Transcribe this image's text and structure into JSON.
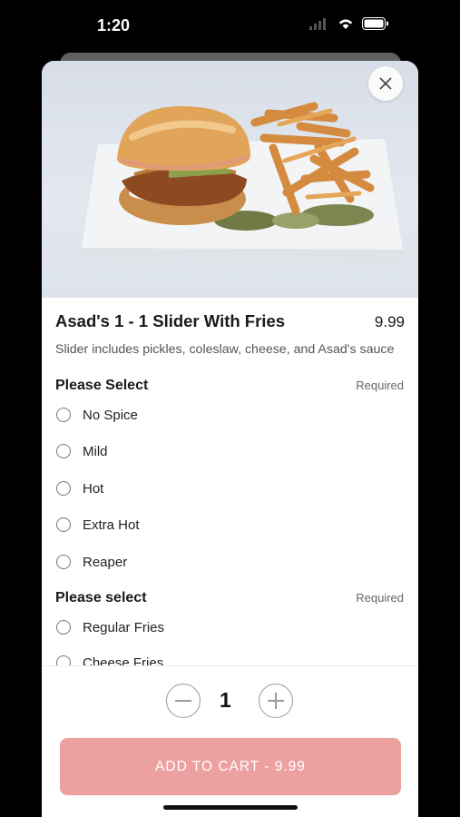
{
  "status": {
    "time": "1:20"
  },
  "item": {
    "title": "Asad's 1 - 1 Slider With Fries",
    "price": "9.99",
    "description": "Slider includes pickles, coleslaw, cheese, and Asad's sauce"
  },
  "groups": [
    {
      "title": "Please Select",
      "required": "Required",
      "options": [
        "No Spice",
        "Mild",
        "Hot",
        "Extra Hot",
        "Reaper"
      ]
    },
    {
      "title": "Please select",
      "required": "Required",
      "options": [
        "Regular Fries",
        "Cheese Fries"
      ]
    }
  ],
  "quantity": "1",
  "cart_button": {
    "label": "ADD TO CART  -  9.99"
  },
  "colors": {
    "button": "#eca0a0",
    "background": "#000000"
  },
  "icons": {
    "close": "close-icon",
    "minus": "minus-icon",
    "plus": "plus-icon",
    "wifi": "wifi-icon",
    "battery": "battery-icon",
    "signal": "signal-icon"
  }
}
